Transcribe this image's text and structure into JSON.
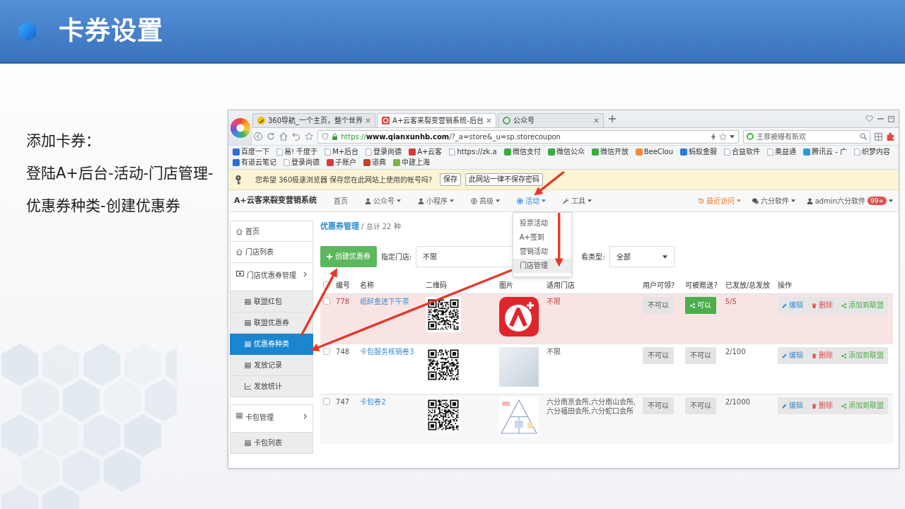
{
  "slide": {
    "title": "卡券设置",
    "lines": [
      "添加卡券：",
      "登陆A+后台-活动-门店管理-",
      "优惠券种类-创建优惠券"
    ]
  },
  "browser": {
    "tabs": [
      {
        "label": "360导航_一个主页，整个世界",
        "selected": false
      },
      {
        "label": "A+云客来裂变营销系统-后台",
        "selected": true
      },
      {
        "label": "公众号",
        "selected": false
      }
    ],
    "address": {
      "scheme": "https://",
      "host": "www.qianxunhb.com",
      "path": "/?_a=store&_u=sp.storecoupon"
    },
    "search": {
      "placeholder": "王菲被曝有新欢"
    },
    "bookmarks": [
      {
        "label": "百度一下",
        "kind": "site",
        "color": "#2f6fd6"
      },
      {
        "label": "易! 千度于",
        "kind": "page"
      },
      {
        "label": "M+后台",
        "kind": "page"
      },
      {
        "label": "登录尚德",
        "kind": "page"
      },
      {
        "label": "A+云客",
        "kind": "site",
        "color": "#d93a3a"
      },
      {
        "label": "https://zk.a",
        "kind": "page"
      },
      {
        "label": "微信支付",
        "kind": "site",
        "color": "#3cab3c"
      },
      {
        "label": "微信公众",
        "kind": "site",
        "color": "#3cab3c"
      },
      {
        "label": "微信开放",
        "kind": "site",
        "color": "#3cab3c"
      },
      {
        "label": "BeeClou",
        "kind": "site",
        "color": "#f08a3c"
      },
      {
        "label": "蚂蚁金服",
        "kind": "site",
        "color": "#2a7fd4"
      },
      {
        "label": "合益软件",
        "kind": "page"
      },
      {
        "label": "奥益通",
        "kind": "page"
      },
      {
        "label": "腾讯云 - 广",
        "kind": "site",
        "color": "#2a9bd8"
      },
      {
        "label": "织梦内容",
        "kind": "page"
      },
      {
        "label": "有道云笔记",
        "kind": "site",
        "color": "#2a6fd6"
      },
      {
        "label": "登录尚德",
        "kind": "page"
      },
      {
        "label": "子账户",
        "kind": "site",
        "color": "#d93a3a"
      },
      {
        "label": "道典",
        "kind": "site",
        "color": "#c8402c"
      },
      {
        "label": "中建上海",
        "kind": "site",
        "color": "#7cb342"
      }
    ],
    "password_bar": {
      "message": "您希望 360极速浏览器 保存您在此网站上使用的帐号吗？",
      "buttons": [
        "保存",
        "此网站一律不保存密码"
      ]
    }
  },
  "app": {
    "brand": "A+云客来裂变营销系统",
    "nav": [
      {
        "label": "首页",
        "kind": "link",
        "selected": false
      },
      {
        "label": "公众号",
        "kind": "menu",
        "selected": false
      },
      {
        "label": "小程序",
        "kind": "menu",
        "selected": false
      },
      {
        "label": "高级",
        "kind": "menu",
        "selected": false
      },
      {
        "label": "活动",
        "kind": "menu",
        "selected": true,
        "menu": [
          {
            "label": "投票活动",
            "selected": false
          },
          {
            "label": "A+签到",
            "selected": false
          },
          {
            "label": "营销活动",
            "selected": false
          },
          {
            "label": "门店管理",
            "selected": true
          }
        ]
      },
      {
        "label": "工具",
        "kind": "menu",
        "selected": false
      }
    ],
    "nav_right": [
      {
        "label": "最近访问",
        "highlighted": true
      },
      {
        "label": "六分软件",
        "highlighted": false
      },
      {
        "label": "admin六分软件",
        "highlighted": false,
        "badge": "99+"
      }
    ],
    "sidebar": [
      {
        "label": "首页",
        "selected": false
      },
      {
        "label": "门店列表",
        "selected": false
      },
      {
        "label": "门店优惠券管理",
        "selected": false,
        "expanded": true,
        "children": [
          {
            "label": "联盟红包",
            "selected": false
          },
          {
            "label": "联盟优惠券",
            "selected": false
          },
          {
            "label": "优惠券种类",
            "selected": true
          },
          {
            "label": "发放记录",
            "selected": false
          },
          {
            "label": "发放统计",
            "selected": false
          }
        ]
      },
      {
        "label": "卡包管理",
        "selected": false,
        "expanded": true,
        "children": [
          {
            "label": "卡包列表",
            "selected": false
          }
        ]
      }
    ],
    "page_header": {
      "title": "优惠券管理",
      "subtitle": "/ 总计 22 种"
    },
    "toolbar": {
      "create_button": "创建优惠券",
      "filters": [
        {
          "label": "指定门店:",
          "value": "不限",
          "kind": "field"
        },
        {
          "label": "看类型:",
          "value": "全部",
          "kind": "select"
        }
      ]
    },
    "table": {
      "select_all": {
        "checked": false
      },
      "columns": [
        "编号",
        "名称",
        "二维码",
        "图片",
        "适用门店",
        "用户可领？",
        "可被赠送?",
        "已发放/总发放",
        "操作"
      ],
      "rows": [
        {
          "id": "778",
          "name": "纸醉金迷下午茶",
          "checked": false,
          "highlighted": true,
          "picture": {
            "kind": "logo"
          },
          "stores": "不限",
          "claimable": {
            "label": "不可以",
            "allowed": false
          },
          "giftable": {
            "label": "可以",
            "allowed": true
          },
          "issued": "5/5",
          "actions": [
            {
              "label": "编辑",
              "kind": "edit"
            },
            {
              "label": "删除",
              "kind": "delete"
            },
            {
              "label": "添加到联盟",
              "kind": "share"
            }
          ]
        },
        {
          "id": "748",
          "name": "卡包服务核销卷3",
          "checked": false,
          "highlighted": false,
          "picture": {
            "kind": "photo"
          },
          "stores": "不限",
          "claimable": {
            "label": "不可以",
            "allowed": false
          },
          "giftable": {
            "label": "不可以",
            "allowed": false
          },
          "issued": "2/100",
          "actions": [
            {
              "label": "编辑",
              "kind": "edit"
            },
            {
              "label": "删除",
              "kind": "delete"
            },
            {
              "label": "添加到联盟",
              "kind": "share"
            }
          ]
        },
        {
          "id": "747",
          "name": "卡包卷2",
          "checked": false,
          "highlighted": false,
          "picture": {
            "kind": "diagram"
          },
          "stores": "六分南京会所,六分南山会所,六分福田会所,六分蛇口会所",
          "claimable": {
            "label": "不可以",
            "allowed": false
          },
          "giftable": {
            "label": "不可以",
            "allowed": false
          },
          "issued": "2/1000",
          "actions": [
            {
              "label": "编辑",
              "kind": "edit"
            },
            {
              "label": "删除",
              "kind": "delete"
            },
            {
              "label": "添加到联盟",
              "kind": "share"
            }
          ]
        }
      ]
    }
  }
}
